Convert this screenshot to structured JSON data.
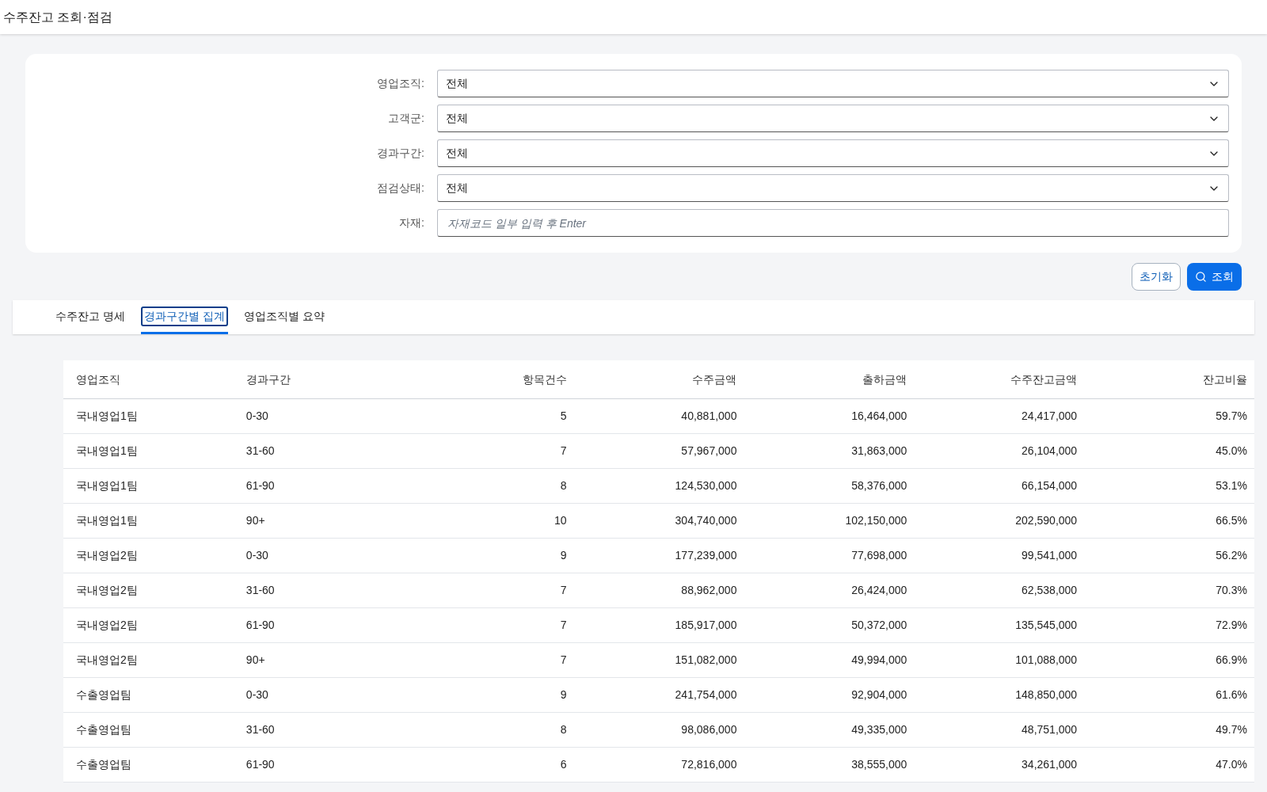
{
  "header": {
    "title": "수주잔고 조회·점검"
  },
  "filters": [
    {
      "label": "영업조직:",
      "kind": "select",
      "value": "전체"
    },
    {
      "label": "고객군:",
      "kind": "select",
      "value": "전체"
    },
    {
      "label": "경과구간:",
      "kind": "select",
      "value": "전체"
    },
    {
      "label": "점검상태:",
      "kind": "select",
      "value": "전체"
    },
    {
      "label": "자재:",
      "kind": "text",
      "placeholder": "자재코드 일부 입력 후 Enter"
    }
  ],
  "buttons": {
    "reset": "초기화",
    "search": "조회"
  },
  "tabs": [
    {
      "label": "수주잔고 명세",
      "selected": false
    },
    {
      "label": "경과구간별 집계",
      "selected": true
    },
    {
      "label": "영업조직별 요약",
      "selected": false
    }
  ],
  "table": {
    "columns": [
      "영업조직",
      "경과구간",
      "항목건수",
      "수주금액",
      "출하금액",
      "수주잔고금액",
      "잔고비율"
    ],
    "rows": [
      [
        "국내영업1팀",
        "0-30",
        "5",
        "40,881,000",
        "16,464,000",
        "24,417,000",
        "59.7%"
      ],
      [
        "국내영업1팀",
        "31-60",
        "7",
        "57,967,000",
        "31,863,000",
        "26,104,000",
        "45.0%"
      ],
      [
        "국내영업1팀",
        "61-90",
        "8",
        "124,530,000",
        "58,376,000",
        "66,154,000",
        "53.1%"
      ],
      [
        "국내영업1팀",
        "90+",
        "10",
        "304,740,000",
        "102,150,000",
        "202,590,000",
        "66.5%"
      ],
      [
        "국내영업2팀",
        "0-30",
        "9",
        "177,239,000",
        "77,698,000",
        "99,541,000",
        "56.2%"
      ],
      [
        "국내영업2팀",
        "31-60",
        "7",
        "88,962,000",
        "26,424,000",
        "62,538,000",
        "70.3%"
      ],
      [
        "국내영업2팀",
        "61-90",
        "7",
        "185,917,000",
        "50,372,000",
        "135,545,000",
        "72.9%"
      ],
      [
        "국내영업2팀",
        "90+",
        "7",
        "151,082,000",
        "49,994,000",
        "101,088,000",
        "66.9%"
      ],
      [
        "수출영업팀",
        "0-30",
        "9",
        "241,754,000",
        "92,904,000",
        "148,850,000",
        "61.6%"
      ],
      [
        "수출영업팀",
        "31-60",
        "8",
        "98,086,000",
        "49,335,000",
        "48,751,000",
        "49.7%"
      ],
      [
        "수출영업팀",
        "61-90",
        "6",
        "72,816,000",
        "38,555,000",
        "34,261,000",
        "47.0%"
      ]
    ]
  }
}
